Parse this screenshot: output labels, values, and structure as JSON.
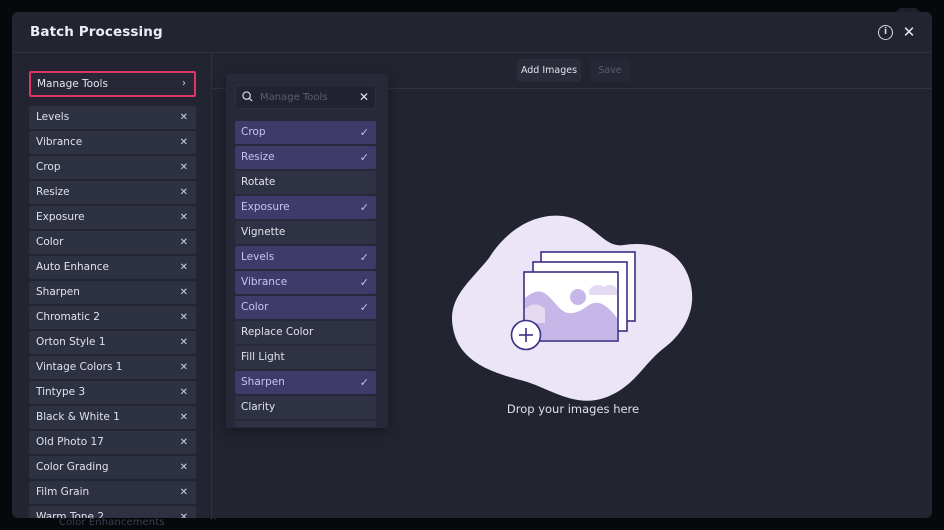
{
  "background": {
    "underlying_label": "Color Enhancements",
    "underlying_chevron": "^"
  },
  "modal": {
    "title": "Batch Processing",
    "info_icon": "info-icon",
    "close_icon": "close-icon",
    "close_glyph": "✕",
    "info_glyph": "i"
  },
  "left_panel": {
    "manage_tools_label": "Manage Tools",
    "manage_tools_chevron": "›",
    "highlight_color": "#e0336a",
    "remove_glyph": "✕",
    "tools": [
      {
        "label": "Levels"
      },
      {
        "label": "Vibrance"
      },
      {
        "label": "Crop"
      },
      {
        "label": "Resize"
      },
      {
        "label": "Exposure"
      },
      {
        "label": "Color"
      },
      {
        "label": "Auto Enhance"
      },
      {
        "label": "Sharpen"
      },
      {
        "label": "Chromatic 2"
      },
      {
        "label": "Orton Style 1"
      },
      {
        "label": "Vintage Colors 1"
      },
      {
        "label": "Tintype 3"
      },
      {
        "label": "Black & White 1"
      },
      {
        "label": "Old Photo 17"
      },
      {
        "label": "Color Grading"
      },
      {
        "label": "Film Grain"
      },
      {
        "label": "Warm Tone 2"
      }
    ]
  },
  "toolbar": {
    "add_images_label": "Add Images",
    "save_label": "Save",
    "save_disabled": true
  },
  "picker": {
    "search_placeholder": "Manage Tools",
    "search_value": "",
    "clear_glyph": "✕",
    "check_glyph": "✓",
    "selected_color": "#3f3a6a",
    "items": [
      {
        "label": "Crop",
        "selected": true
      },
      {
        "label": "Resize",
        "selected": true
      },
      {
        "label": "Rotate",
        "selected": false
      },
      {
        "label": "Exposure",
        "selected": true
      },
      {
        "label": "Vignette",
        "selected": false
      },
      {
        "label": "Levels",
        "selected": true
      },
      {
        "label": "Vibrance",
        "selected": true
      },
      {
        "label": "Color",
        "selected": true
      },
      {
        "label": "Replace Color",
        "selected": false
      },
      {
        "label": "Fill Light",
        "selected": false
      },
      {
        "label": "Sharpen",
        "selected": true
      },
      {
        "label": "Clarity",
        "selected": false
      }
    ]
  },
  "dropzone": {
    "text": "Drop your images here",
    "illustration": "image-stack-add-icon",
    "blob_color": "#ece4f7",
    "accent_color": "#3b2f86"
  }
}
